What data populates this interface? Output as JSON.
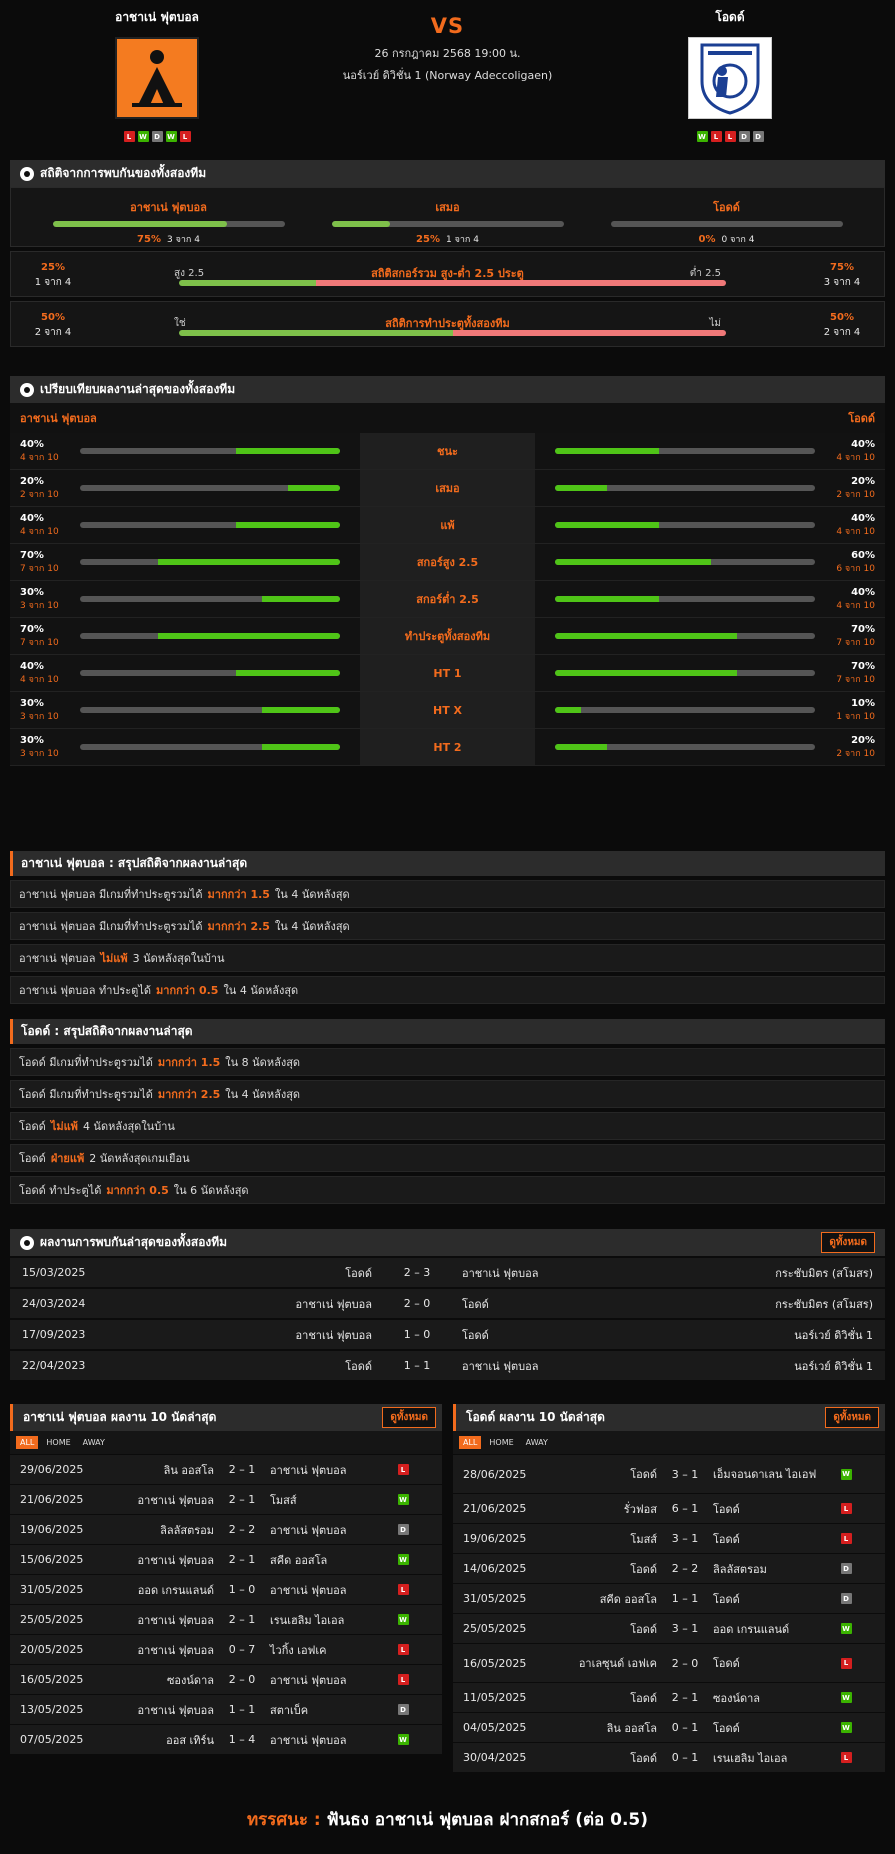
{
  "header": {
    "home_name": "อาชาเน่ ฟุตบอล",
    "away_name": "โอดด์",
    "vs": "VS",
    "datetime": "26 กรกฎาคม 2568 19:00 น.",
    "league": "นอร์เวย์ ดิวิชั่น 1 (Norway Adeccoligaen)",
    "home_form": [
      "L",
      "W",
      "D",
      "W",
      "L"
    ],
    "away_form": [
      "W",
      "L",
      "L",
      "D",
      "D"
    ]
  },
  "h2h": {
    "title": "สถิติจากการพบกันของทั้งสองทีม",
    "items": [
      {
        "label": "อาชาเน่ ฟุตบอล",
        "pct": "75%",
        "sub": "3 จาก 4",
        "fill": 0.75
      },
      {
        "label": "เสมอ",
        "pct": "25%",
        "sub": "1 จาก 4",
        "fill": 0.25
      },
      {
        "label": "โอดด์",
        "pct": "0%",
        "sub": "0 จาก 4",
        "fill": 0
      }
    ],
    "ou": {
      "title": "สถิติสกอร์รวม สูง-ต่ำ 2.5 ประตู",
      "left_pct": "25%",
      "left_sub": "1 จาก 4",
      "right_pct": "75%",
      "right_sub": "3 จาก 4",
      "left_text": "สูง 2.5",
      "right_text": "ต่ำ 2.5",
      "fill": 0.25
    },
    "btts": {
      "title": "สถิติการทำประตูทั้งสองทีม",
      "left_pct": "50%",
      "left_sub": "2 จาก 4",
      "right_pct": "50%",
      "right_sub": "2 จาก 4",
      "left_text": "ใช่",
      "right_text": "ไม่",
      "fill": 0.5
    }
  },
  "compare": {
    "title": "เปรียบเทียบผลงานล่าสุดของทั้งสองทีม",
    "home": "อาชาเน่ ฟุตบอล",
    "away": "โอดด์",
    "rows": [
      {
        "label": "ชนะ",
        "hp": "40%",
        "hs": "4 จาก 10",
        "hf": 0.4,
        "ap": "40%",
        "as": "4 จาก 10",
        "af": 0.4
      },
      {
        "label": "เสมอ",
        "hp": "20%",
        "hs": "2 จาก 10",
        "hf": 0.2,
        "ap": "20%",
        "as": "2 จาก 10",
        "af": 0.2
      },
      {
        "label": "แพ้",
        "hp": "40%",
        "hs": "4 จาก 10",
        "hf": 0.4,
        "ap": "40%",
        "as": "4 จาก 10",
        "af": 0.4
      },
      {
        "label": "สกอร์สูง 2.5",
        "hp": "70%",
        "hs": "7 จาก 10",
        "hf": 0.7,
        "ap": "60%",
        "as": "6 จาก 10",
        "af": 0.6
      },
      {
        "label": "สกอร์ต่ำ 2.5",
        "hp": "30%",
        "hs": "3 จาก 10",
        "hf": 0.3,
        "ap": "40%",
        "as": "4 จาก 10",
        "af": 0.4
      },
      {
        "label": "ทำประตูทั้งสองทีม",
        "hp": "70%",
        "hs": "7 จาก 10",
        "hf": 0.7,
        "ap": "70%",
        "as": "7 จาก 10",
        "af": 0.7
      },
      {
        "label": "HT 1",
        "hp": "40%",
        "hs": "4 จาก 10",
        "hf": 0.4,
        "ap": "70%",
        "as": "7 จาก 10",
        "af": 0.7
      },
      {
        "label": "HT X",
        "hp": "30%",
        "hs": "3 จาก 10",
        "hf": 0.3,
        "ap": "10%",
        "as": "1 จาก 10",
        "af": 0.1
      },
      {
        "label": "HT 2",
        "hp": "30%",
        "hs": "3 จาก 10",
        "hf": 0.3,
        "ap": "20%",
        "as": "2 จาก 10",
        "af": 0.2
      }
    ]
  },
  "home_summary": {
    "title": "อาชาเน่ ฟุตบอล : สรุปสถิติจากผลงานล่าสุด",
    "items": [
      {
        "pre": "อาชาเน่ ฟุตบอล มีเกมที่ทำประตูรวมได้",
        "hl": "มากกว่า 1.5",
        "post": "ใน 4 นัดหลังสุด"
      },
      {
        "pre": "อาชาเน่ ฟุตบอล มีเกมที่ทำประตูรวมได้",
        "hl": "มากกว่า 2.5",
        "post": "ใน 4 นัดหลังสุด"
      },
      {
        "pre": "อาชาเน่ ฟุตบอล",
        "hl": "ไม่แพ้",
        "post": "3 นัดหลังสุดในบ้าน"
      },
      {
        "pre": "อาชาเน่ ฟุตบอล ทำประตูได้",
        "hl": "มากกว่า 0.5",
        "post": "ใน 4 นัดหลังสุด"
      }
    ]
  },
  "away_summary": {
    "title": "โอดด์ : สรุปสถิติจากผลงานล่าสุด",
    "items": [
      {
        "pre": "โอดด์ มีเกมที่ทำประตูรวมได้",
        "hl": "มากกว่า 1.5",
        "post": "ใน 8 นัดหลังสุด"
      },
      {
        "pre": "โอดด์ มีเกมที่ทำประตูรวมได้",
        "hl": "มากกว่า 2.5",
        "post": "ใน 4 นัดหลังสุด"
      },
      {
        "pre": "โอดด์",
        "hl": "ไม่แพ้",
        "post": "4 นัดหลังสุดในบ้าน"
      },
      {
        "pre": "โอดด์",
        "hl": "ฝ่ายแพ้",
        "post": "2 นัดหลังสุดเกมเยือน"
      },
      {
        "pre": "โอดด์ ทำประตูได้",
        "hl": "มากกว่า 0.5",
        "post": "ใน 6 นัดหลังสุด"
      }
    ]
  },
  "h2h_matches": {
    "title": "ผลงานการพบกันล่าสุดของทั้งสองทีม",
    "view_all": "ดูทั้งหมด",
    "rows": [
      {
        "date": "15/03/2025",
        "home": "โอดด์",
        "score": "2 – 3",
        "away": "อาชาเน่ ฟุตบอล",
        "comp": "กระชับมิตร (สโมสร)"
      },
      {
        "date": "24/03/2024",
        "home": "อาชาเน่ ฟุตบอล",
        "score": "2 – 0",
        "away": "โอดด์",
        "comp": "กระชับมิตร (สโมสร)"
      },
      {
        "date": "17/09/2023",
        "home": "อาชาเน่ ฟุตบอล",
        "score": "1 – 0",
        "away": "โอดด์",
        "comp": "นอร์เวย์ ดิวิชั่น 1"
      },
      {
        "date": "22/04/2023",
        "home": "โอดด์",
        "score": "1 – 1",
        "away": "อาชาเน่ ฟุตบอล",
        "comp": "นอร์เวย์ ดิวิชั่น 1"
      }
    ]
  },
  "home_last": {
    "title": "อาชาเน่ ฟุตบอล ผลงาน 10 นัดล่าสุด",
    "view_all": "ดูทั้งหมด",
    "tabs": [
      "ALL",
      "HOME",
      "AWAY"
    ],
    "rows": [
      {
        "date": "29/06/2025",
        "home": "ลิน ออสโล",
        "score": "2 – 1",
        "away": "อาชาเน่ ฟุตบอล",
        "res": "L"
      },
      {
        "date": "21/06/2025",
        "home": "อาชาเน่ ฟุตบอล",
        "score": "2 – 1",
        "away": "โมสส์",
        "res": "W"
      },
      {
        "date": "19/06/2025",
        "home": "ลิลลัสตรอม",
        "score": "2 – 2",
        "away": "อาชาเน่ ฟุตบอล",
        "res": "D"
      },
      {
        "date": "15/06/2025",
        "home": "อาชาเน่ ฟุตบอล",
        "score": "2 – 1",
        "away": "สคีด ออสโล",
        "res": "W"
      },
      {
        "date": "31/05/2025",
        "home": "ออด เกรนแลนด์",
        "score": "1 – 0",
        "away": "อาชาเน่ ฟุตบอล",
        "res": "L"
      },
      {
        "date": "25/05/2025",
        "home": "อาชาเน่ ฟุตบอล",
        "score": "2 – 1",
        "away": "เรนเฮลิม ไอเอล",
        "res": "W"
      },
      {
        "date": "20/05/2025",
        "home": "อาชาเน่ ฟุตบอล",
        "score": "0 – 7",
        "away": "ไวกิ้ง เอฟเค",
        "res": "L"
      },
      {
        "date": "16/05/2025",
        "home": "ซองน์ดาล",
        "score": "2 – 0",
        "away": "อาชาเน่ ฟุตบอล",
        "res": "L"
      },
      {
        "date": "13/05/2025",
        "home": "อาชาเน่ ฟุตบอล",
        "score": "1 – 1",
        "away": "สตาเบ็ค",
        "res": "D"
      },
      {
        "date": "07/05/2025",
        "home": "ออส เทิร์น",
        "score": "1 – 4",
        "away": "อาชาเน่ ฟุตบอล",
        "res": "W"
      }
    ]
  },
  "away_last": {
    "title": "โอดด์ ผลงาน 10 นัดล่าสุด",
    "view_all": "ดูทั้งหมด",
    "tabs": [
      "ALL",
      "HOME",
      "AWAY"
    ],
    "rows": [
      {
        "date": "28/06/2025",
        "home": "โอดด์",
        "score": "3 – 1",
        "away": "เอ็มจอนดาเลน ไอเอฟ",
        "res": "W"
      },
      {
        "date": "21/06/2025",
        "home": "รั่วฟอส",
        "score": "6 – 1",
        "away": "โอดด์",
        "res": "L"
      },
      {
        "date": "19/06/2025",
        "home": "โมสส์",
        "score": "3 – 1",
        "away": "โอดด์",
        "res": "L"
      },
      {
        "date": "14/06/2025",
        "home": "โอดด์",
        "score": "2 – 2",
        "away": "ลิลลัสตรอม",
        "res": "D"
      },
      {
        "date": "31/05/2025",
        "home": "สคีด ออสโล",
        "score": "1 – 1",
        "away": "โอดด์",
        "res": "D"
      },
      {
        "date": "25/05/2025",
        "home": "โอดด์",
        "score": "3 – 1",
        "away": "ออด เกรนแลนด์",
        "res": "W"
      },
      {
        "date": "16/05/2025",
        "home": "อาเลซุนด์ เอฟเค",
        "score": "2 – 0",
        "away": "โอดด์",
        "res": "L"
      },
      {
        "date": "11/05/2025",
        "home": "โอดด์",
        "score": "2 – 1",
        "away": "ซองน์ดาล",
        "res": "W"
      },
      {
        "date": "04/05/2025",
        "home": "ลิน ออสโล",
        "score": "0 – 1",
        "away": "โอดด์",
        "res": "W"
      },
      {
        "date": "30/04/2025",
        "home": "โอดด์",
        "score": "0 – 1",
        "away": "เรนเฮลิม ไอเอล",
        "res": "L"
      }
    ]
  },
  "footer": {
    "label": "ทรรศนะ :",
    "text": "ฟันธง อาชาเน่ ฟุตบอล ฝากสกอร์ (ต่อ 0.5)"
  },
  "colors": {
    "accent": "#f26b1d",
    "win": "#3bb300",
    "loss": "#d51f1f",
    "draw": "#777777",
    "bar_green": "#7ec04a",
    "bar_red": "#f07878"
  }
}
